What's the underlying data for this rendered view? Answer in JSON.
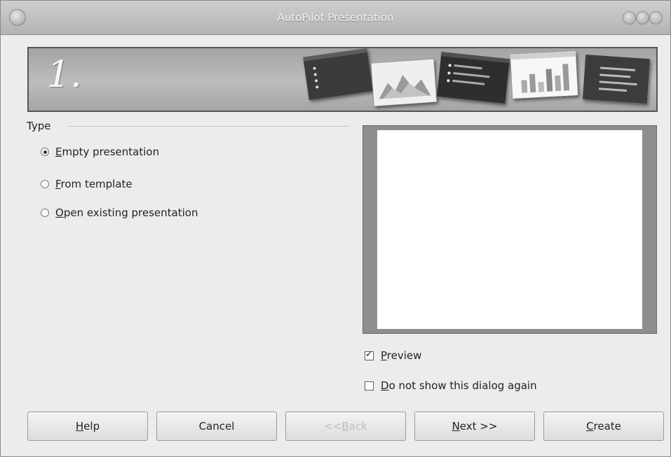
{
  "window": {
    "title": "AutoPilot Presentation"
  },
  "banner": {
    "step": "1."
  },
  "type_group": {
    "label": "Type",
    "options": [
      {
        "accel": "E",
        "rest": "mpty presentation",
        "selected": true
      },
      {
        "accel": "F",
        "rest": "rom template",
        "selected": false
      },
      {
        "accel": "O",
        "rest": "pen existing presentation",
        "selected": false
      }
    ]
  },
  "checks": {
    "preview": {
      "accel": "P",
      "rest": "review",
      "checked": true
    },
    "dont_show": {
      "accel": "D",
      "rest": "o not show this dialog again",
      "checked": false
    }
  },
  "buttons": {
    "help": {
      "accel": "H",
      "rest": "elp"
    },
    "cancel": {
      "label": "Cancel"
    },
    "back": {
      "pre": "<< ",
      "accel": "B",
      "rest": "ack"
    },
    "next": {
      "accel": "N",
      "rest": "ext >>"
    },
    "create": {
      "accel": "C",
      "rest": "reate"
    }
  }
}
